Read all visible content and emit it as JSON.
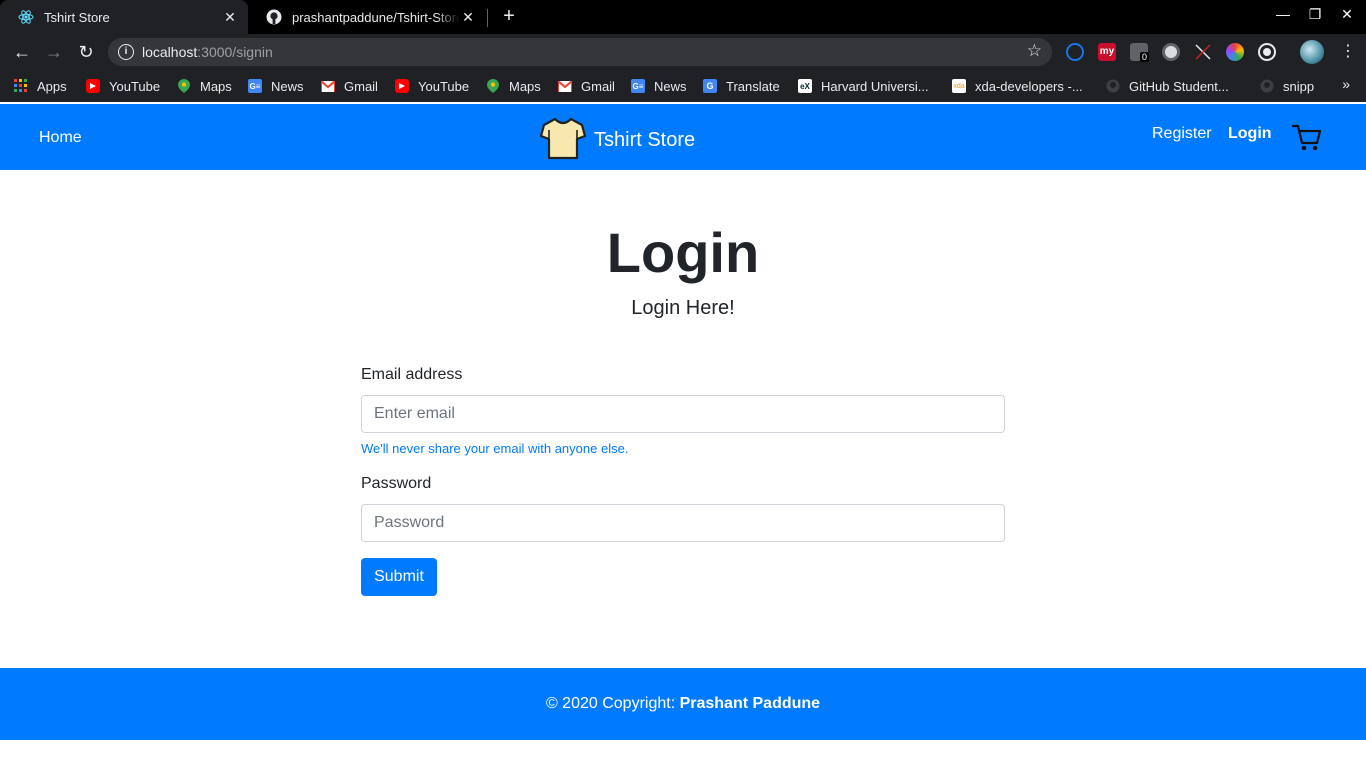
{
  "browser": {
    "tabs": [
      {
        "title": "Tshirt Store",
        "active": true,
        "icon": "react-icon"
      },
      {
        "title": "prashantpaddune/Tshirt-Store",
        "active": false,
        "icon": "github-icon"
      }
    ],
    "url_host": "localhost",
    "url_path": ":3000/signin",
    "bookmarks": [
      {
        "label": "Apps",
        "icon": "apps-grid-icon"
      },
      {
        "label": "YouTube",
        "icon": "youtube-icon"
      },
      {
        "label": "Maps",
        "icon": "maps-icon"
      },
      {
        "label": "News",
        "icon": "google-news-icon"
      },
      {
        "label": "Gmail",
        "icon": "gmail-icon"
      },
      {
        "label": "YouTube",
        "icon": "youtube-icon"
      },
      {
        "label": "Maps",
        "icon": "maps-icon"
      },
      {
        "label": "Gmail",
        "icon": "gmail-icon"
      },
      {
        "label": "News",
        "icon": "google-news-icon"
      },
      {
        "label": "Translate",
        "icon": "translate-icon"
      },
      {
        "label": "Harvard Universi...",
        "icon": "edx-icon"
      },
      {
        "label": "xda-developers -...",
        "icon": "xda-icon"
      },
      {
        "label": "GitHub Student...",
        "icon": "github-icon"
      },
      {
        "label": "snipp",
        "icon": "github-icon"
      }
    ],
    "extension_badge": "0"
  },
  "navbar": {
    "home": "Home",
    "brand": "Tshirt Store",
    "register": "Register",
    "login": "Login"
  },
  "main": {
    "title": "Login",
    "subtitle": "Login Here!",
    "form": {
      "email_label": "Email address",
      "email_placeholder": "Enter email",
      "email_help": "We'll never share your email with anyone else.",
      "password_label": "Password",
      "password_placeholder": "Password",
      "submit": "Submit"
    }
  },
  "footer": {
    "prefix": "© 2020 Copyright: ",
    "author": "Prashant Paddune"
  },
  "colors": {
    "primary": "#007bff",
    "chrome_dark": "#202124"
  }
}
